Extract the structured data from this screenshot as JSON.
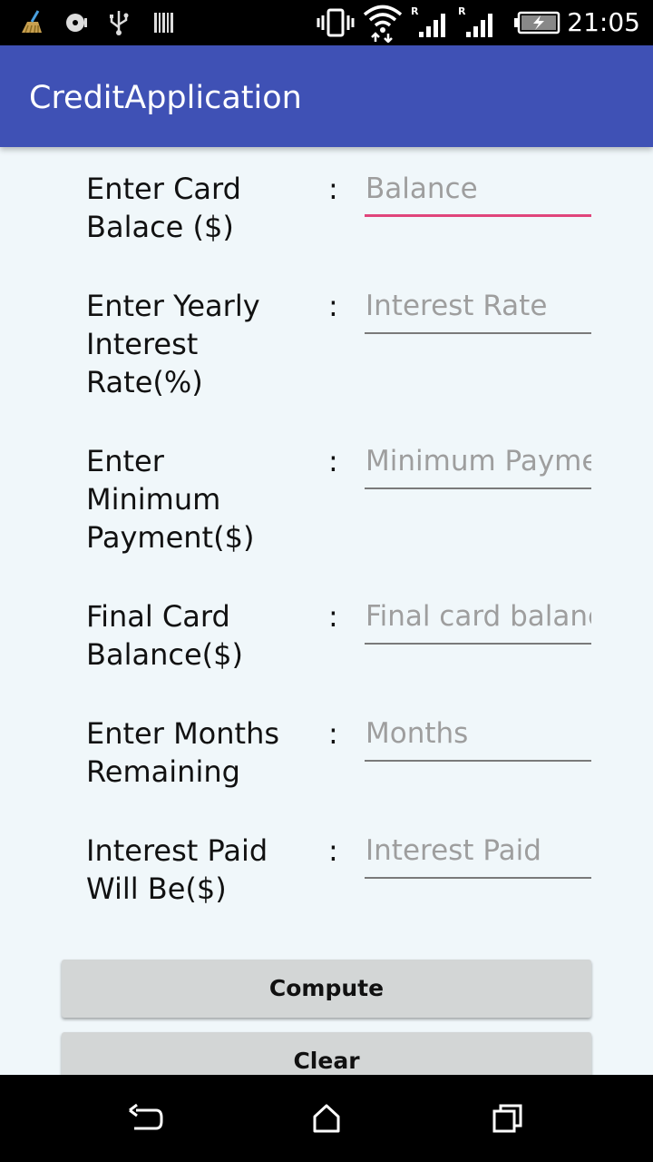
{
  "status_bar": {
    "time": "21:05",
    "icons": [
      "cleaner-icon",
      "disc-icon",
      "usb-icon",
      "barcode-icon",
      "vibrate-icon",
      "wifi-icon",
      "signal-icon",
      "signal-icon",
      "battery-charging-icon"
    ],
    "roaming_label": "R"
  },
  "app_bar": {
    "title": "CreditApplication"
  },
  "form": {
    "colon": ":",
    "rows": [
      {
        "label": "Enter Card Balace ($)",
        "placeholder": "Balance",
        "value": ""
      },
      {
        "label": "Enter Yearly Interest Rate(%)",
        "placeholder": "Interest Rate",
        "value": ""
      },
      {
        "label": "Enter Minimum Payment($)",
        "placeholder": "Minimum Payment",
        "value": ""
      },
      {
        "label": "Final Card Balance($)",
        "placeholder": "Final card balance",
        "value": ""
      },
      {
        "label": "Enter Months Remaining",
        "placeholder": "Months",
        "value": ""
      },
      {
        "label": "Interest Paid Will Be($)",
        "placeholder": "Interest Paid",
        "value": ""
      }
    ],
    "compute_label": "Compute",
    "clear_label": "Clear"
  },
  "nav_bar": {
    "icons": [
      "back-icon",
      "home-icon",
      "recents-icon"
    ]
  },
  "colors": {
    "app_bar": "#3f51b5",
    "accent": "#e0457b",
    "background": "#f0f7fa",
    "button": "#d3d6d6"
  }
}
